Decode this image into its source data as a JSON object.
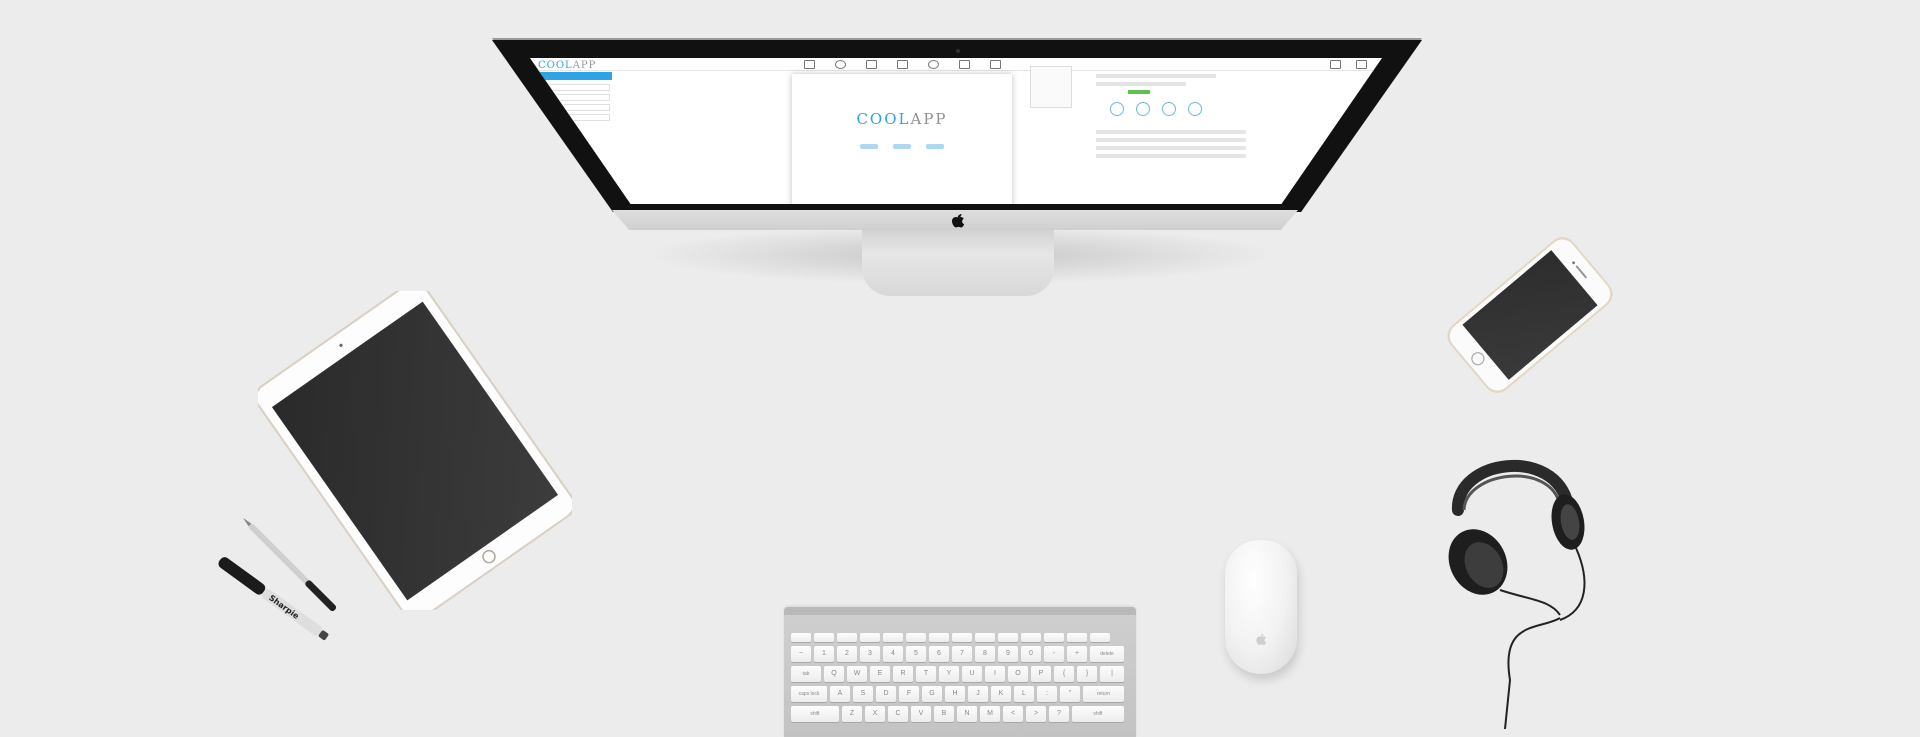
{
  "scene": {
    "background_color": "#ececec",
    "accent_color": "#2fa3e6"
  },
  "imac_screen": {
    "app_logo": {
      "part_a": "COOL",
      "part_b": "APP"
    },
    "canvas_logo": {
      "part_a": "COOL",
      "part_b": "APP"
    }
  },
  "keyboard": {
    "row_numbers": [
      "~",
      "1",
      "2",
      "3",
      "4",
      "5",
      "6",
      "7",
      "8",
      "9",
      "0",
      "-",
      "+",
      "delete"
    ],
    "row_qwerty": [
      "tab",
      "Q",
      "W",
      "E",
      "R",
      "T",
      "Y",
      "U",
      "I",
      "O",
      "P",
      "{",
      "}",
      "|"
    ],
    "row_home": [
      "caps lock",
      "A",
      "S",
      "D",
      "F",
      "G",
      "H",
      "J",
      "K",
      "L",
      ":",
      "\"",
      "return"
    ],
    "row_bottom": [
      "shift",
      "Z",
      "X",
      "C",
      "V",
      "B",
      "N",
      "M",
      "<",
      ">",
      "?",
      "shift"
    ]
  },
  "objects": {
    "pen_brand": "Sharpie",
    "icons": [
      "apple-logo-icon",
      "apple-logo-icon"
    ]
  }
}
